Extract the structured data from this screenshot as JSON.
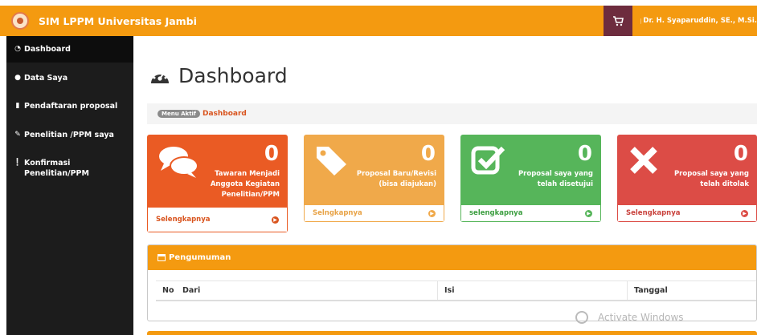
{
  "header": {
    "app_title": "SIM LPPM Universitas Jambi",
    "user_name": "Dr. H. Syaparuddin, SE., M.Si."
  },
  "sidebar": {
    "items": [
      {
        "label": "Dashboard",
        "icon": "dashboard-icon"
      },
      {
        "label": "Data Saya",
        "icon": "user-icon"
      },
      {
        "label": "Pendaftaran proposal",
        "icon": "file-icon"
      },
      {
        "label": "Penelitian /PPM saya",
        "icon": "edit-icon"
      },
      {
        "label": "Konfirmasi",
        "label2": "Penelitian/PPM",
        "icon": "info-circle-icon"
      }
    ]
  },
  "main": {
    "page_title": "Dashboard",
    "breadcrumb": {
      "badge": "Menu Aktif",
      "current": "Dashboard"
    }
  },
  "cards": [
    {
      "count": "0",
      "line1": "Tawaran Menjadi",
      "line2": "Anggota Kegiatan",
      "line3": "Penelitian/PPM",
      "link": "Selengkapnya",
      "color": "#ea5b24",
      "icon": "comments-icon"
    },
    {
      "count": "0",
      "line1": "Proposal Baru/Revisi",
      "line2": "(bisa diajukan)",
      "link": "Selngkapnya",
      "color": "#f0a94a",
      "icon": "tag-icon"
    },
    {
      "count": "0",
      "line1": "Proposal saya yang",
      "line2": "telah disetujui",
      "link": "selengkapnya",
      "color": "#56b55a",
      "icon": "check-square-icon"
    },
    {
      "count": "0",
      "line1": "Proposal saya yang",
      "line2": "telah ditolak",
      "link": "Selengkapnya",
      "color": "#dc4c46",
      "icon": "times-icon"
    }
  ],
  "announcements": {
    "title": "Pengumuman",
    "columns": [
      "No",
      "Dari",
      "Isi",
      "Tanggal"
    ]
  },
  "colors": {
    "accent": "#f49a10",
    "sidebar": "#1c1c1c",
    "cart_button": "#6d2c3e"
  },
  "watermark": "Activate Windows"
}
